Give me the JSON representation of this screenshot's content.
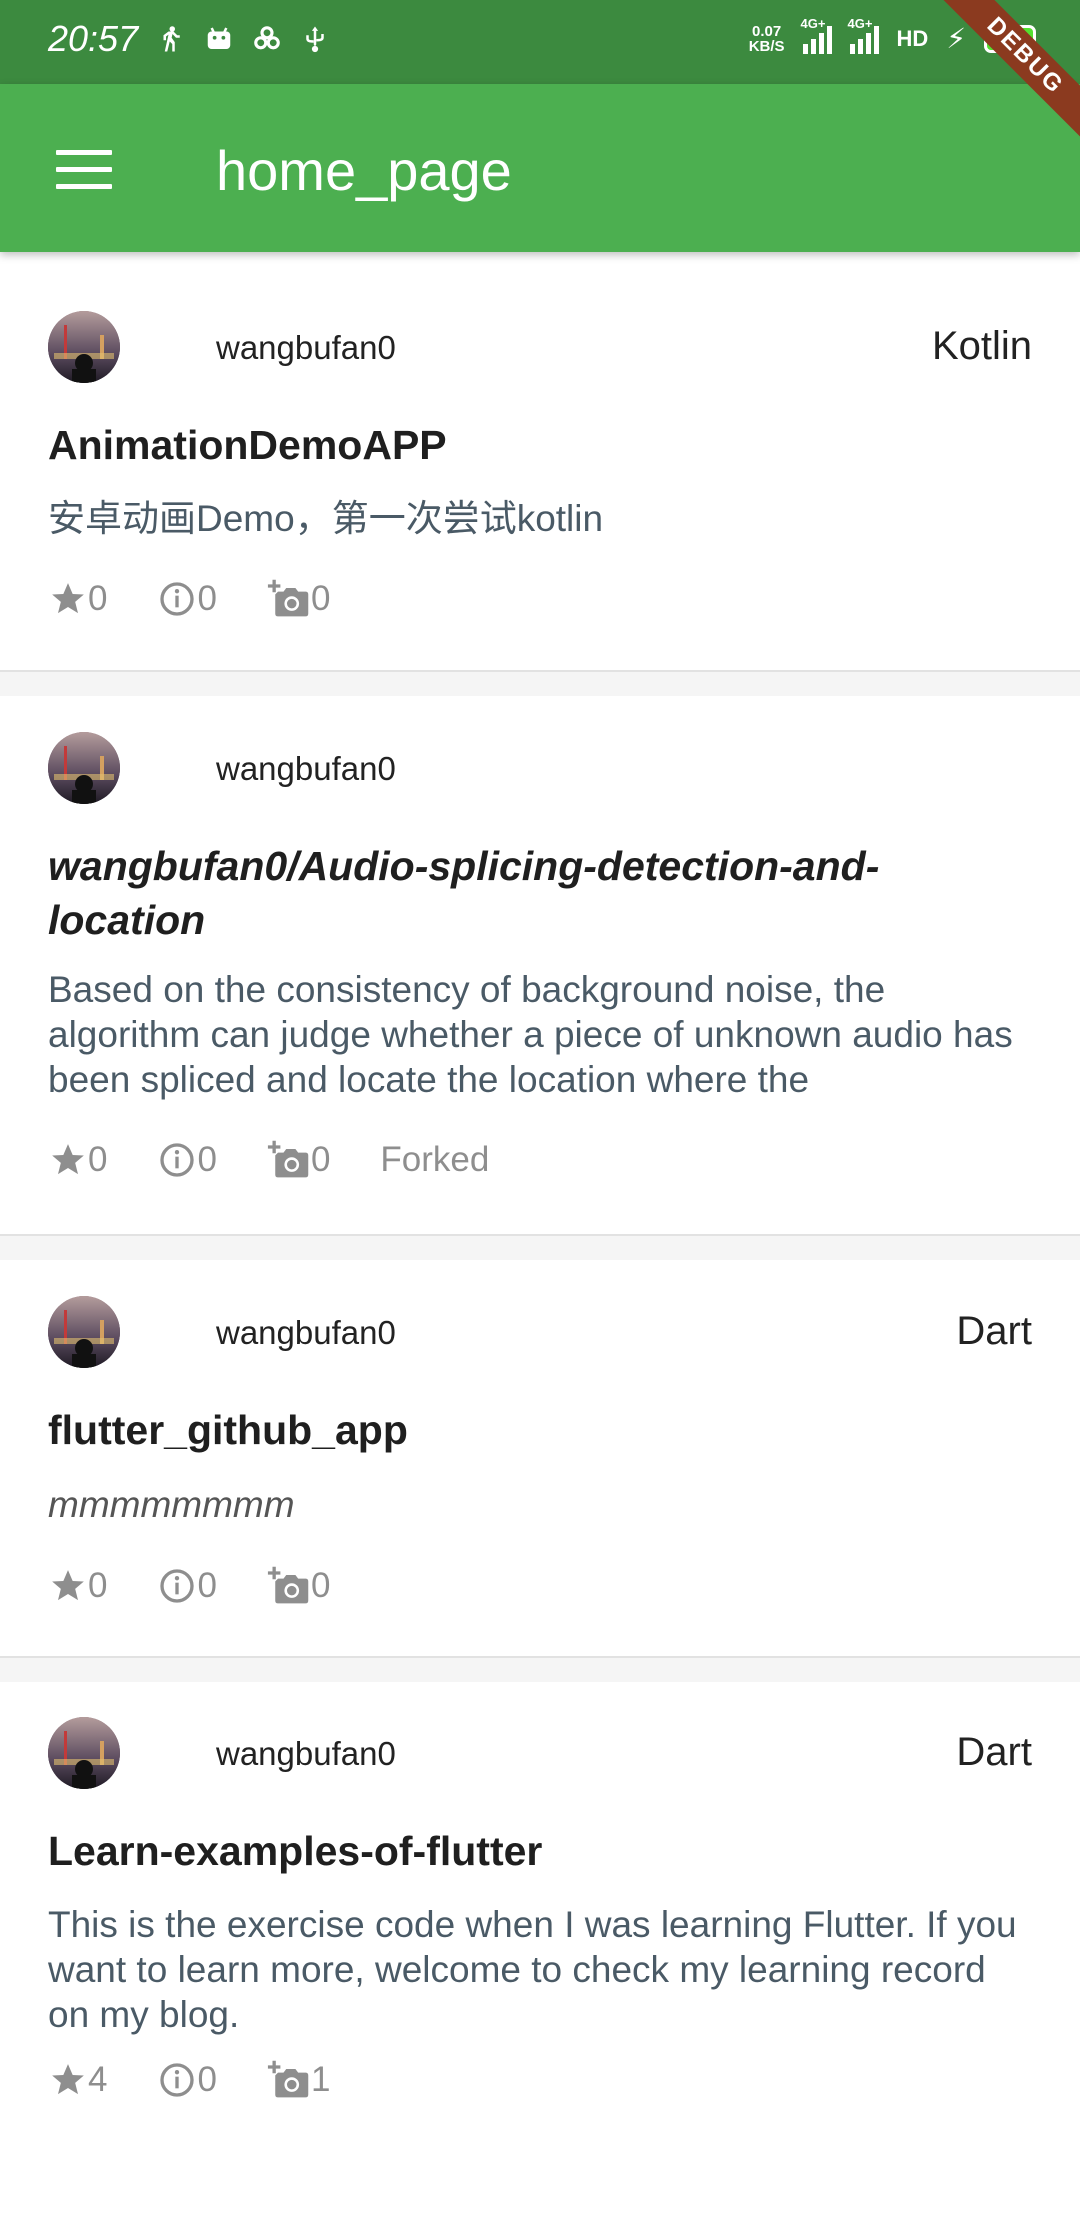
{
  "status_bar": {
    "time": "20:57",
    "speed_value": "0.07",
    "speed_unit": "KB/S",
    "network1": "4G+",
    "network2": "4G+",
    "hd_label": "HD",
    "battery_level": "90"
  },
  "debug_banner": "DEBUG",
  "app_bar": {
    "title": "home_page"
  },
  "repos": [
    {
      "owner": "wangbufan0",
      "language": "Kotlin",
      "name": "AnimationDemoAPP",
      "description": "安卓动画Demo，第一次尝试kotlin",
      "stars": "0",
      "issues": "0",
      "forks": "0",
      "forked_label": ""
    },
    {
      "owner": "wangbufan0",
      "language": "",
      "name": "wangbufan0/Audio-splicing-detection-and-location",
      "description": "Based on the consistency of background noise, the algorithm can judge whether a piece of unknown audio has been spliced and locate the location where the",
      "stars": "0",
      "issues": "0",
      "forks": "0",
      "forked_label": "Forked"
    },
    {
      "owner": "wangbufan0",
      "language": "Dart",
      "name": "flutter_github_app",
      "description": "mmmmmmmm",
      "stars": "0",
      "issues": "0",
      "forks": "0",
      "forked_label": ""
    },
    {
      "owner": "wangbufan0",
      "language": "Dart",
      "name": "Learn-examples-of-flutter",
      "description": "This is the exercise code when I was learning Flutter. If you want to learn more, welcome to check my learning record on my blog.",
      "stars": "4",
      "issues": "0",
      "forks": "1",
      "forked_label": ""
    }
  ],
  "colors": {
    "status_bar": "#3c8a3f",
    "app_bar": "#4caf50",
    "debug_banner": "#8b3a1f"
  }
}
